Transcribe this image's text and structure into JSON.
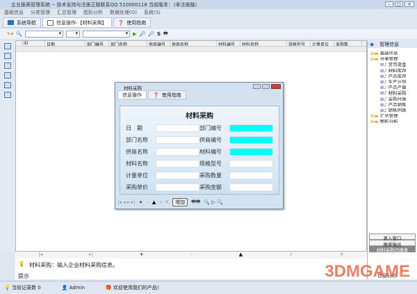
{
  "window": {
    "title": "企业报表管理系统 -- 技术支持与注册正版联系QQ 510000118    当前版本：（非注册版）"
  },
  "menu": [
    "基础信息",
    "分类管理",
    "汇总管理",
    "图形分析",
    "数据处理(O)",
    "系统(S)"
  ],
  "tabs": [
    {
      "label": "系统导航"
    },
    {
      "label": "信息操作-【材料采购】"
    },
    {
      "label": "使用指南"
    }
  ],
  "grid": {
    "columns": [
      "ID",
      "日期",
      "部门编号",
      "部门名称",
      "供商编号",
      "供商名称",
      "材料编号",
      "材料名称",
      "规格型号",
      "计量单位",
      "采购数"
    ]
  },
  "right_panel": {
    "header": "管理信息",
    "tree": [
      {
        "label": "基础信息",
        "level": 0,
        "type": "folder"
      },
      {
        "label": "分类管理",
        "level": 0,
        "type": "folder"
      },
      {
        "label": "货币资金",
        "level": 1
      },
      {
        "label": "材料库存",
        "level": 1
      },
      {
        "label": "产品库存",
        "level": 1
      },
      {
        "label": "生产计划",
        "level": 1
      },
      {
        "label": "产品产量",
        "level": 1
      },
      {
        "label": "材料采购",
        "level": 1
      },
      {
        "label": "采购付款",
        "level": 1
      },
      {
        "label": "产品销售",
        "level": 1
      },
      {
        "label": "销售回款",
        "level": 1
      },
      {
        "label": "汇总管理",
        "level": 0,
        "type": "folder"
      },
      {
        "label": "图形分析",
        "level": 0,
        "type": "folder"
      }
    ],
    "buttons": [
      "录入窗口",
      "报表输出",
      "材料采购日报表"
    ],
    "footer": "信息分析"
  },
  "dialog": {
    "title": "材料采购",
    "tabs": [
      "信息操作",
      "使用指南"
    ],
    "heading": "材料采购",
    "left_fields": [
      "日　期",
      "部门名称",
      "供商名称",
      "材料名称",
      "计量单位",
      "采购单价"
    ],
    "right_fields": [
      "部门编号",
      "供商编号",
      "材料编号",
      "规格型号",
      "采购数量",
      "采购金额"
    ],
    "add_button": "增加"
  },
  "hint": {
    "text": "材料采购：输入企业材料采购信息。",
    "label": "提示"
  },
  "status": {
    "records": "当前记录数 0",
    "user": "Admin",
    "welcome": "欢迎使用我们的产品!"
  },
  "watermark": "3DMGAME"
}
